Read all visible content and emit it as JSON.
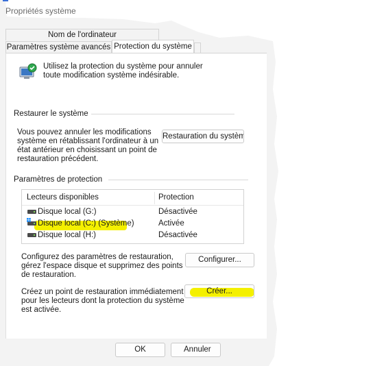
{
  "window": {
    "title": "Propriétés système"
  },
  "tabs": [
    {
      "label": "Nom de l'ordinateur"
    },
    {
      "label": "Paramètres système avancés"
    },
    {
      "label": "Protection du système"
    },
    {
      "label": ""
    }
  ],
  "intro": {
    "text": "Utilisez la protection du système pour annuler toute modification système indésirable.",
    "icon": "system-protection-icon"
  },
  "restore": {
    "group_label": "Restaurer le système",
    "description": "Vous pouvez annuler les modifications système en rétablissant l'ordinateur à un état antérieur en choisissant un point de restauration précédent.",
    "button_label": "Restauration du système..."
  },
  "protection": {
    "group_label": "Paramètres de protection",
    "columns": {
      "drives": "Lecteurs disponibles",
      "protection": "Protection"
    },
    "drives": [
      {
        "name": "Disque local (G:)",
        "status": "Désactivée",
        "icon": "drive-icon"
      },
      {
        "name": "Disque local (C:) (Système)",
        "status": "Activée",
        "icon": "windows-drive-icon"
      },
      {
        "name": "Disque local (H:)",
        "status": "Désactivée",
        "icon": "drive-icon"
      }
    ],
    "configure": {
      "description": "Configurez des paramètres de restauration, gérez l'espace disque et supprimez des points de restauration.",
      "button_label": "Configurer..."
    },
    "create": {
      "description": "Créez un point de restauration immédiatement pour les lecteurs dont la protection du système est activée.",
      "button_label": "Créer..."
    }
  },
  "footer": {
    "ok_label": "OK",
    "cancel_label": "Annuler"
  },
  "colors": {
    "highlight": "#f4f000",
    "accent": "#3a6fd8",
    "windows_logo": "#1e90ff"
  }
}
